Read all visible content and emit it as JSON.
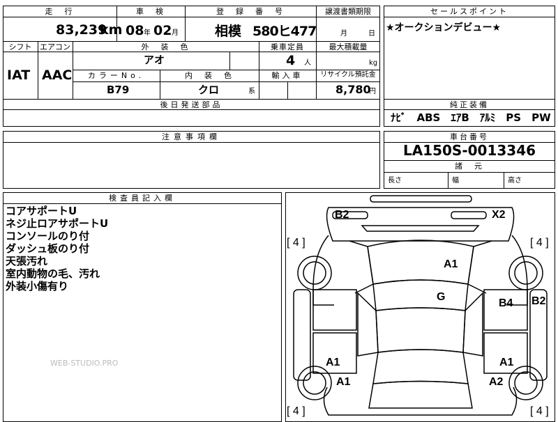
{
  "headers": {
    "mileage": "走　行",
    "inspection": "車　検",
    "registration": "登　録　番　号",
    "transfer_deadline": "譲渡書類期限",
    "sales_point": "セールスポイント",
    "shift": "シフト",
    "aircon": "エアコン",
    "exterior_color": "外　装　色",
    "capacity": "乗車定員",
    "max_load": "最大積載量",
    "color_no": "カラーNo.",
    "interior_color": "内　装　色",
    "import": "輸入車",
    "recycle": "リサイクル預託金",
    "later_parts": "後日発送部品",
    "standard_equipment": "純正装備",
    "notes": "注意事項欄",
    "chassis": "車台番号",
    "dimensions": "諸　元",
    "inspector": "検査員記入欄"
  },
  "values": {
    "mileage": "83,239",
    "mileage_unit": "km",
    "insp_year": "08",
    "insp_year_unit": "年",
    "insp_month": "02",
    "insp_month_unit": "月",
    "plate_region": "相模",
    "plate_number": "580ヒ477",
    "deadline_month": "月",
    "deadline_day": "日",
    "sales_point": "★オークションデビュー★",
    "shift": "IAT",
    "aircon": "AAC",
    "exterior_color": "アオ",
    "capacity": "4",
    "capacity_unit": "人",
    "max_load_unit": "kg",
    "color_no": "B79",
    "interior_color": "クロ",
    "interior_suffix": "系",
    "recycle": "8,780",
    "recycle_unit": "円",
    "standard_equipment": "ﾅﾋﾞ　ABS　ｴｱB　ｱﾙﾐ　PS　PW",
    "chassis": "LA150S-0013346",
    "length_label": "長さ",
    "width_label": "幅",
    "height_label": "高さ"
  },
  "inspector_notes": [
    "コアサポートU",
    "ネジ止ロアサポートU",
    "コンソールのり付",
    "ダッシュ板のり付",
    "天張汚れ",
    "室内動物の毛、汚れ",
    "外装小傷有り"
  ],
  "diagram_marks": {
    "b2_top": "B2",
    "x2_top": "X2",
    "tire_fl": "[ 4 ]",
    "tire_fr": "[ 4 ]",
    "a1_roof": "A1",
    "g_center": "G",
    "b4_right": "B4",
    "b2_right": "B2",
    "a1_left_door": "A1",
    "a1_right_door": "A1",
    "a1_left_rear": "A1",
    "a2_right_rear": "A2",
    "tire_rl": "[ 4 ]",
    "tire_rr": "[ 4 ]"
  },
  "watermark": "WEB-STUDIO.PRO"
}
